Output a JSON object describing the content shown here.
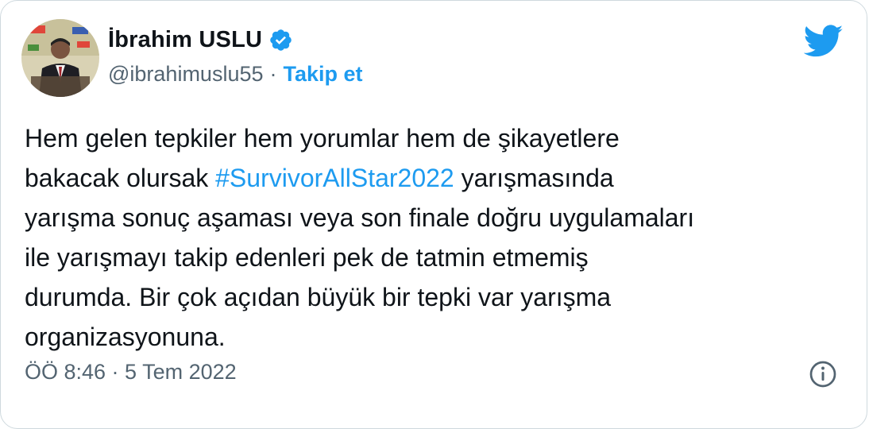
{
  "tweet": {
    "author": {
      "display_name": "İbrahim USLU",
      "verified": true,
      "handle": "@ibrahimuslu55"
    },
    "separator": "·",
    "follow_label": "Takip et",
    "text_lines": [
      "Hem gelen tepkiler hem yorumlar hem de şikayetlere",
      "bakacak olursak ",
      " yarışmasında",
      "yarışma sonuç aşaması veya son finale doğru uygulamaları",
      "ile yarışmayı takip edenleri  pek de tatmin etmemiş",
      "durumda. Bir çok açıdan büyük bir tepki var yarışma",
      "organizasyonuna."
    ],
    "hashtag": "#SurvivorAllStar2022",
    "timestamp": "ÖÖ 8:46 · 5 Tem 2022"
  },
  "colors": {
    "accent": "#1d9bf0",
    "text": "#0f1419",
    "muted": "#536471",
    "border": "#cfd9de"
  },
  "icons": [
    "verified-badge-icon",
    "twitter-bird-icon",
    "info-icon"
  ]
}
